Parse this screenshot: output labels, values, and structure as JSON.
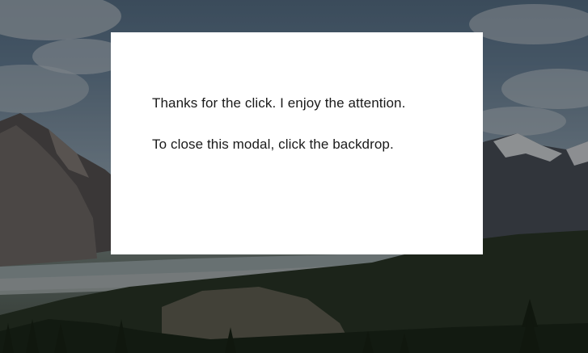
{
  "background": {
    "description_icon": "mountain-landscape-image"
  },
  "modal": {
    "line1": "Thanks for the click. I enjoy the attention.",
    "line2": "To close this modal, click the backdrop."
  }
}
